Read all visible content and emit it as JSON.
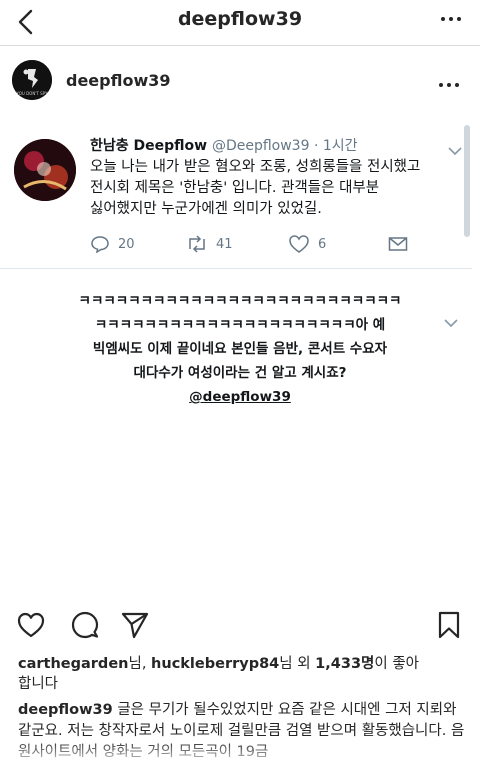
{
  "topnav": {
    "title": "deepflow39",
    "back_icon": "chevron-left-icon",
    "more_icon": "more-horizontal-icon"
  },
  "post": {
    "username": "deepflow39",
    "avatar_caption": "YOU DON'T SPY",
    "more_icon": "more-horizontal-icon"
  },
  "tweet": {
    "name": "한남충 Deepflow",
    "handle": "@Deepflow39 · 1시간",
    "text_lines": [
      "오늘 나는 내가 받은 혐오와 조롱, 성희롱들을 전시했고",
      "전시회 제목은 '한남충' 입니다. 관객들은 대부분",
      "싫어했지만 누군가에겐 의미가 있었길."
    ],
    "replies": "20",
    "retweets": "41",
    "likes": "6"
  },
  "reply": {
    "lines": [
      "ㅋㅋㅋㅋㅋㅋㅋㅋㅋㅋㅋㅋㅋㅋㅋㅋㅋㅋㅋㅋㅋㅋㅋㅋㅋㅋ",
      "ㅋㅋㅋㅋㅋㅋㅋㅋㅋㅋㅋㅋㅋㅋㅋㅋㅋㅋㅋㅋㅋ아 예",
      "빅엠씨도 이제 끝이네요 본인들 음반, 콘서트 수요자",
      "대다수가 여성이라는 건 알고 계시죠?"
    ],
    "mention": "@deepflow39"
  },
  "actions": {
    "like_icon": "heart-icon",
    "comment_icon": "comment-icon",
    "share_icon": "send-icon",
    "save_icon": "bookmark-icon"
  },
  "likes": {
    "user1": "carthegarden",
    "sep1": "님, ",
    "user2": "huckleberryp84",
    "sep2": "님 외 ",
    "count": "1,433명",
    "suffix": "이 좋아",
    "line2": "합니다"
  },
  "caption": {
    "user": "deepflow39",
    "text": " 글은 무기가 될수있었지만 요즘 같은 시대엔 그저 지뢰와 같군요. 저는 창작자로서 노이로제 걸릴만큼 검열 받으며 활동했습니다. 음원사이트에서 양화는 거의 모든곡이 19금"
  },
  "colors": {
    "text": "#262626",
    "twitter_text": "#14171a",
    "twitter_gray": "#657786",
    "border": "#dbdbdb"
  }
}
